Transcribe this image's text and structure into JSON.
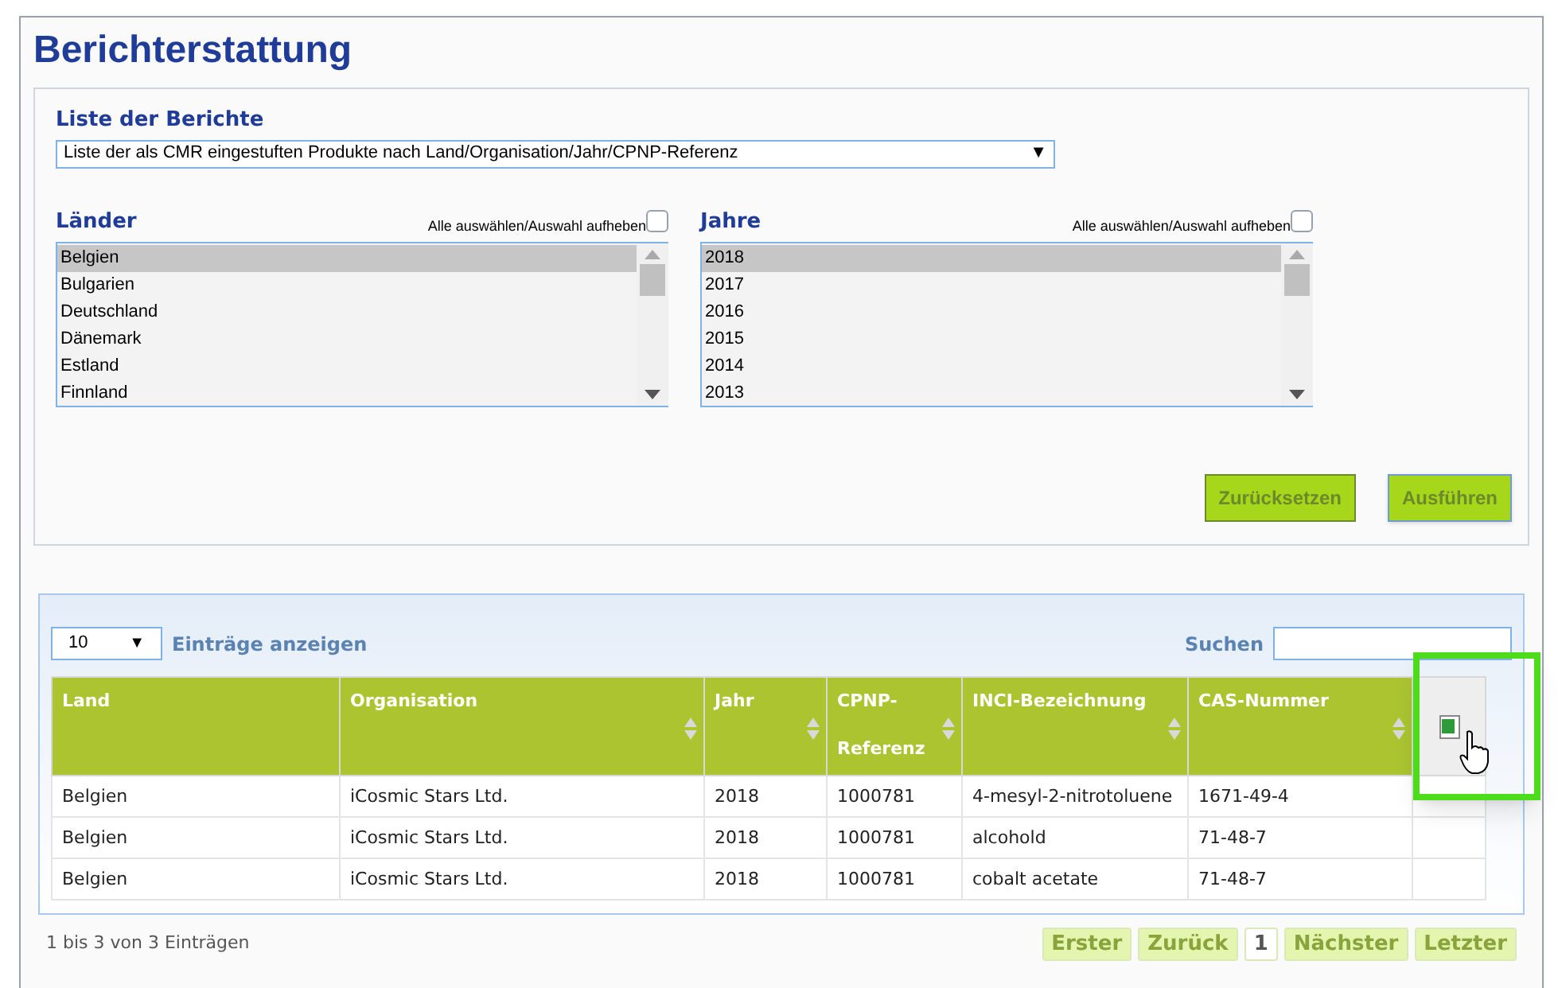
{
  "title": "Berichterstattung",
  "report_list": {
    "label": "Liste der Berichte",
    "value": "Liste der als CMR eingestuften Produkte nach Land/Organisation/Jahr/CPNP-Referenz",
    "caret": "▼"
  },
  "filters": [
    {
      "label": "Länder",
      "select_all_label": "Alle auswählen/Auswahl aufheben",
      "select_all_checked": false,
      "options": [
        {
          "label": "Belgien",
          "selected": true
        },
        {
          "label": "Bulgarien",
          "selected": false
        },
        {
          "label": "Deutschland",
          "selected": false
        },
        {
          "label": "Dänemark",
          "selected": false
        },
        {
          "label": "Estland",
          "selected": false
        },
        {
          "label": "Finnland",
          "selected": false
        }
      ]
    },
    {
      "label": "Jahre",
      "select_all_label": "Alle auswählen/Auswahl aufheben",
      "select_all_checked": false,
      "options": [
        {
          "label": "2018",
          "selected": true
        },
        {
          "label": "2017",
          "selected": false
        },
        {
          "label": "2016",
          "selected": false
        },
        {
          "label": "2015",
          "selected": false
        },
        {
          "label": "2014",
          "selected": false
        },
        {
          "label": "2013",
          "selected": false
        }
      ]
    }
  ],
  "buttons": [
    {
      "label": "Zurücksetzen",
      "focused": false
    },
    {
      "label": "Ausführen",
      "focused": true
    }
  ],
  "table": {
    "page_size": "10",
    "page_size_caret": "▼",
    "page_size_label": "Einträge anzeigen",
    "search_label": "Suchen",
    "columns": [
      {
        "label": "Land",
        "sortable": false
      },
      {
        "label": "Organisation",
        "sortable": true
      },
      {
        "label": "Jahr",
        "sortable": true
      },
      {
        "label": "CPNP-Referenz",
        "sortable": true
      },
      {
        "label": "INCI-Bezeichnung",
        "sortable": true
      },
      {
        "label": "CAS-Nummer",
        "sortable": true
      }
    ],
    "rows": [
      [
        "Belgien",
        "iCosmic Stars Ltd.",
        "2018",
        "1000781",
        "4-mesyl-2-nitrotoluene",
        "1671-49-4"
      ],
      [
        "Belgien",
        "iCosmic Stars Ltd.",
        "2018",
        "1000781",
        "alcohold",
        "71-48-7"
      ],
      [
        "Belgien",
        "iCosmic Stars Ltd.",
        "2018",
        "1000781",
        "cobalt acetate",
        "71-48-7"
      ]
    ],
    "info": "1 bis 3 von 3 Einträgen",
    "pagination": [
      {
        "label": "Erster",
        "kind": "nav"
      },
      {
        "label": "Zurück",
        "kind": "nav"
      },
      {
        "label": "1",
        "kind": "page"
      },
      {
        "label": "Nächster",
        "kind": "nav"
      },
      {
        "label": "Letzter",
        "kind": "nav"
      }
    ]
  }
}
